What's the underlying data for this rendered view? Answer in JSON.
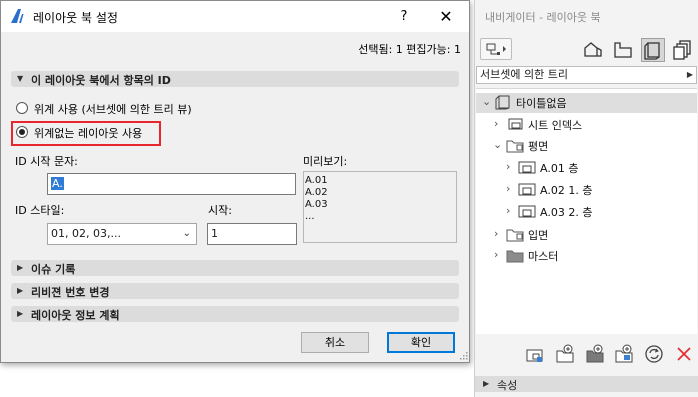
{
  "dialog": {
    "title": "레이아웃 북 설정",
    "help": "?",
    "close": "✕",
    "selection_info": "선택됨: 1 편집가능: 1",
    "id_section": {
      "title": "이 레이아웃 북에서 항목의 ID",
      "radio_hierarchy": "위계 사용 (서브셋에 의한 트리 뷰)",
      "radio_no_hierarchy": "위계없는 레이아웃 사용",
      "selected": "radio_no_hierarchy",
      "prefix_label": "ID 시작 문자:",
      "prefix_value": "A.",
      "style_label": "ID 스타일:",
      "style_value": "01, 02, 03,...",
      "start_label": "시작:",
      "start_value": "1",
      "preview_label": "미리보기:",
      "preview_lines": [
        "A.01",
        "A.02",
        "A.03",
        "..."
      ]
    },
    "sections": {
      "issue_history": "이슈 기록",
      "revision_numbering": "리비젼 번호 변경",
      "layout_info_scheme": "레이아웃 정보 계획"
    },
    "buttons": {
      "cancel": "취소",
      "ok": "확인"
    }
  },
  "navigator": {
    "title": "내비게이터 - 레이아웃 북",
    "tree_mode": "서브셋에 의한 트리",
    "tree": {
      "root": "타이틀없음",
      "sheet_index": "시트 인덱스",
      "floor_plan": "평면",
      "sheets": [
        "A.01 층",
        "A.02 1. 층",
        "A.03 2. 층"
      ],
      "elevation": "입면",
      "master": "마스터"
    },
    "properties": "속성"
  },
  "colors": {
    "accent": "#0078d7",
    "highlight": "#e8262d",
    "selection": "#2f7bd6",
    "delete": "#e8262d"
  }
}
